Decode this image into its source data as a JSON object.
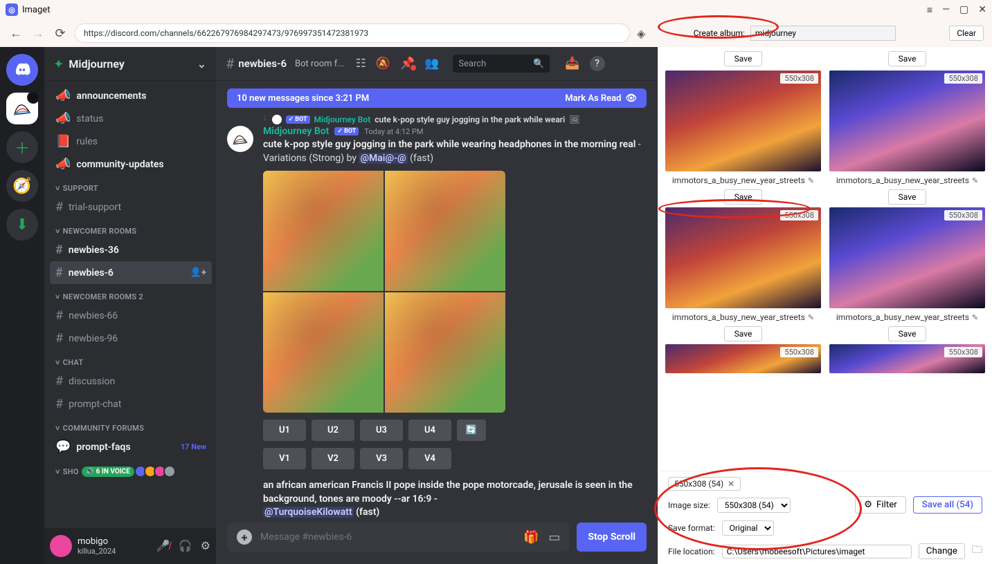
{
  "title_bar": {
    "app_name": "Imaget"
  },
  "address_bar": {
    "url": "https://discord.com/channels/662267976984297473/976997351472381973",
    "create_album_label": "Create album:",
    "album_value": "midjourney",
    "clear_label": "Clear"
  },
  "discord": {
    "server_name": "Midjourney",
    "channel_header": {
      "name": "newbies-6",
      "topic": "Bot room f...",
      "search_placeholder": "Search"
    },
    "channels_top": [
      {
        "name": "announcements",
        "icon": "megaphone",
        "bold": true
      },
      {
        "name": "status",
        "icon": "megaphone",
        "bold": false
      },
      {
        "name": "rules",
        "icon": "rules",
        "bold": false
      },
      {
        "name": "community-updates",
        "icon": "megaphone",
        "bold": true
      }
    ],
    "categories": [
      {
        "label": "SUPPORT",
        "channels": [
          {
            "name": "trial-support",
            "icon": "hash"
          }
        ]
      },
      {
        "label": "NEWCOMER ROOMS",
        "channels": [
          {
            "name": "newbies-36",
            "icon": "hash",
            "bold": true
          },
          {
            "name": "newbies-6",
            "icon": "hash",
            "bold": true,
            "selected": true
          }
        ]
      },
      {
        "label": "NEWCOMER ROOMS 2",
        "channels": [
          {
            "name": "newbies-66",
            "icon": "hash"
          },
          {
            "name": "newbies-96",
            "icon": "hash"
          }
        ]
      },
      {
        "label": "CHAT",
        "channels": [
          {
            "name": "discussion",
            "icon": "hash"
          },
          {
            "name": "prompt-chat",
            "icon": "hash"
          }
        ]
      },
      {
        "label": "COMMUNITY FORUMS",
        "channels": [
          {
            "name": "prompt-faqs",
            "icon": "forum",
            "bold": true,
            "badge": "17 New"
          }
        ]
      }
    ],
    "voice_chip": "6 IN VOICE",
    "show_label": "SHO",
    "new_messages_bar": {
      "text": "10 new messages since 3:21 PM",
      "mark": "Mark As Read"
    },
    "reply": {
      "bot_tag": "✓ BOT",
      "bot_name": "Midjourney Bot",
      "snippet": "cute k-pop style guy jogging in the park while weari"
    },
    "message": {
      "author": "Midjourney Bot",
      "bot_tag": "✓ BOT",
      "timestamp": "Today at 4:12 PM",
      "prompt_strong": "cute k-pop style guy jogging in the park while wearing headphones in the morning real",
      "prompt_tail": " - Variations (Strong) by ",
      "mention": "@Mai@-@",
      "speed": " (fast)",
      "u_buttons": [
        "U1",
        "U2",
        "U3",
        "U4"
      ],
      "v_buttons": [
        "V1",
        "V2",
        "V3",
        "V4"
      ],
      "second_prompt_strong": "an african american Francis II pope inside the pope motorcade, jerusale is seen in the background, tones are moody --ar 16:9",
      "second_mention": "@TurquoiseKilowatt",
      "second_speed": " (fast)"
    },
    "input_placeholder": "Message #newbies-6",
    "stop_scroll": "Stop Scroll",
    "user_footer": {
      "name": "mobigo",
      "tag": "killua_2024"
    }
  },
  "imaget": {
    "thumbnails": [
      {
        "size": "550x308",
        "filename": "immotors_a_busy_new_year_streets",
        "variant": "warm"
      },
      {
        "size": "550x308",
        "filename": "immotors_a_busy_new_year_streets",
        "variant": "cool"
      },
      {
        "size": "550x308",
        "filename": "immotors_a_busy_new_year_streets",
        "variant": "warm"
      },
      {
        "size": "550x308",
        "filename": "immotors_a_busy_new_year_streets",
        "variant": "cool"
      }
    ],
    "partial_size": "550x308",
    "save_label": "Save",
    "chip": "550x308 (54)",
    "image_size_label": "Image size:",
    "image_size_value": "550x308 (54)",
    "filter_label": "Filter",
    "save_all_label": "Save all (54)",
    "save_format_label": "Save format:",
    "save_format_value": "Original",
    "file_location_label": "File location:",
    "file_location_value": "C:\\Users\\mobeesoft\\Pictures\\imaget",
    "change_label": "Change"
  }
}
